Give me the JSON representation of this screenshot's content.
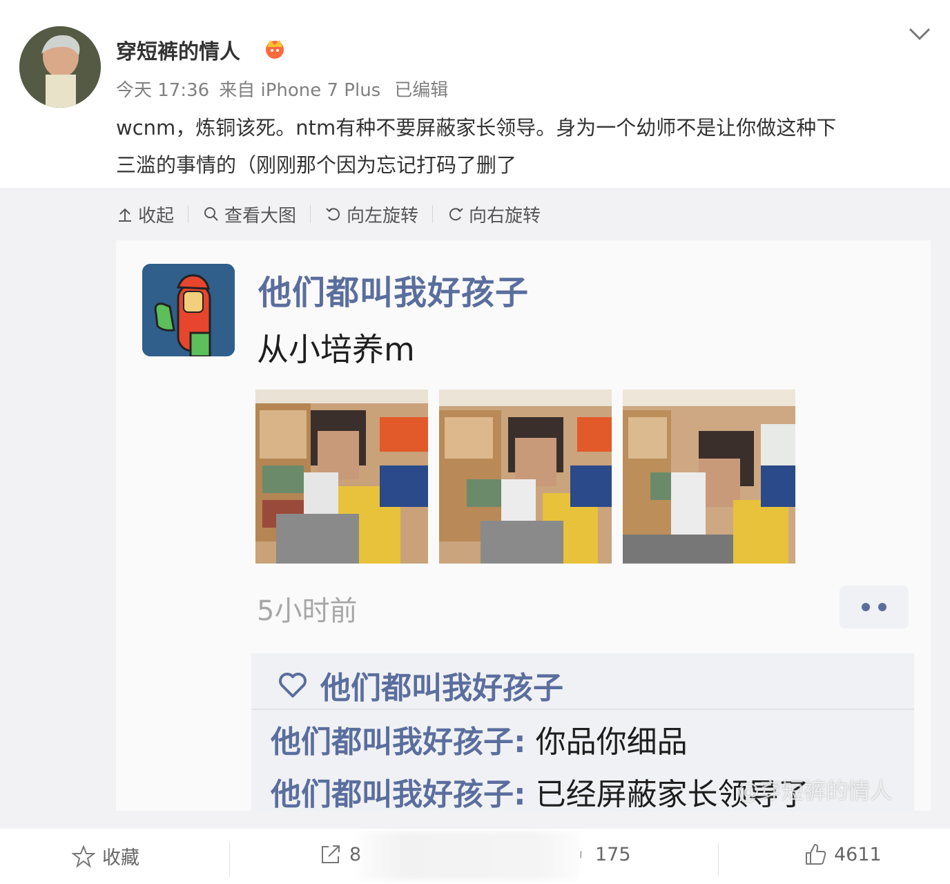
{
  "post": {
    "username": "穿短裤的情人",
    "time": "今天 17:36",
    "source": "来自 iPhone 7 Plus",
    "edited": "已编辑",
    "text_line1": "wcnm，炼铜该死。ntm有种不要屏蔽家长领导。身为一个幼师不是让你做这种下",
    "text_line2": "三滥的事情的（刚刚那个因为忘记打码了删了"
  },
  "toolbar": {
    "collapse": "收起",
    "view_large": "查看大图",
    "rotate_left": "向左旋转",
    "rotate_right": "向右旋转"
  },
  "screenshot": {
    "author": "他们都叫我好孩子",
    "text": "从小培养m",
    "time": "5小时前",
    "like_name": "他们都叫我好孩子",
    "comments": [
      {
        "author": "他们都叫我好孩子",
        "text": "你品你细品"
      },
      {
        "author": "他们都叫我好孩子",
        "text": "已经屏蔽家长领导了"
      }
    ],
    "watermark": "@穿短裤的情人"
  },
  "actions": {
    "favorite": "收藏",
    "repost_count": "8",
    "comment_count": "175",
    "like_count": "4611"
  },
  "colors": {
    "accent_name": "#5a6e9e",
    "meta_gray": "#808080",
    "media_bg": "#f2f2f5"
  },
  "icons": [
    "chevron-down-icon",
    "crown-icon",
    "collapse-icon",
    "search-icon",
    "rotate-left-icon",
    "rotate-right-icon",
    "heart-icon",
    "more-icon",
    "star-icon",
    "share-icon",
    "comment-icon",
    "thumbs-up-icon"
  ]
}
